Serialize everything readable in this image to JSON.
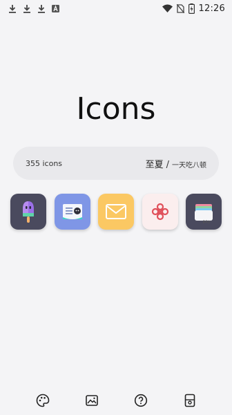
{
  "status_bar": {
    "time": "12:26",
    "left_icons": [
      "download-icon",
      "download-icon",
      "download-icon",
      "a-notification-icon"
    ],
    "right_icons": [
      "wifi-icon",
      "no-sim-icon",
      "battery-charging-icon"
    ]
  },
  "header": {
    "title": "Icons"
  },
  "info": {
    "icon_count": "355 icons",
    "author_name": "至夏",
    "separator": "/",
    "author_tag": "一天吃八顿"
  },
  "preview_icons": [
    {
      "name": "popsicle-app-icon",
      "bg": "#4a4a5e"
    },
    {
      "name": "reader-app-icon",
      "bg": "#7f96e6"
    },
    {
      "name": "mail-app-icon",
      "bg": "#fbc863"
    },
    {
      "name": "china-unicom-app-icon",
      "bg": "#fbeeee"
    },
    {
      "name": "wallet-pay-app-icon",
      "bg": "#4a4a5e"
    }
  ],
  "wallet_label": "pay",
  "bottom_nav": [
    {
      "name": "palette-icon"
    },
    {
      "name": "wallpaper-icon"
    },
    {
      "name": "help-icon"
    },
    {
      "name": "apply-icon"
    }
  ],
  "colors": {
    "background": "#f4f4f6",
    "pill": "#e9e9ec",
    "text": "#111111"
  }
}
